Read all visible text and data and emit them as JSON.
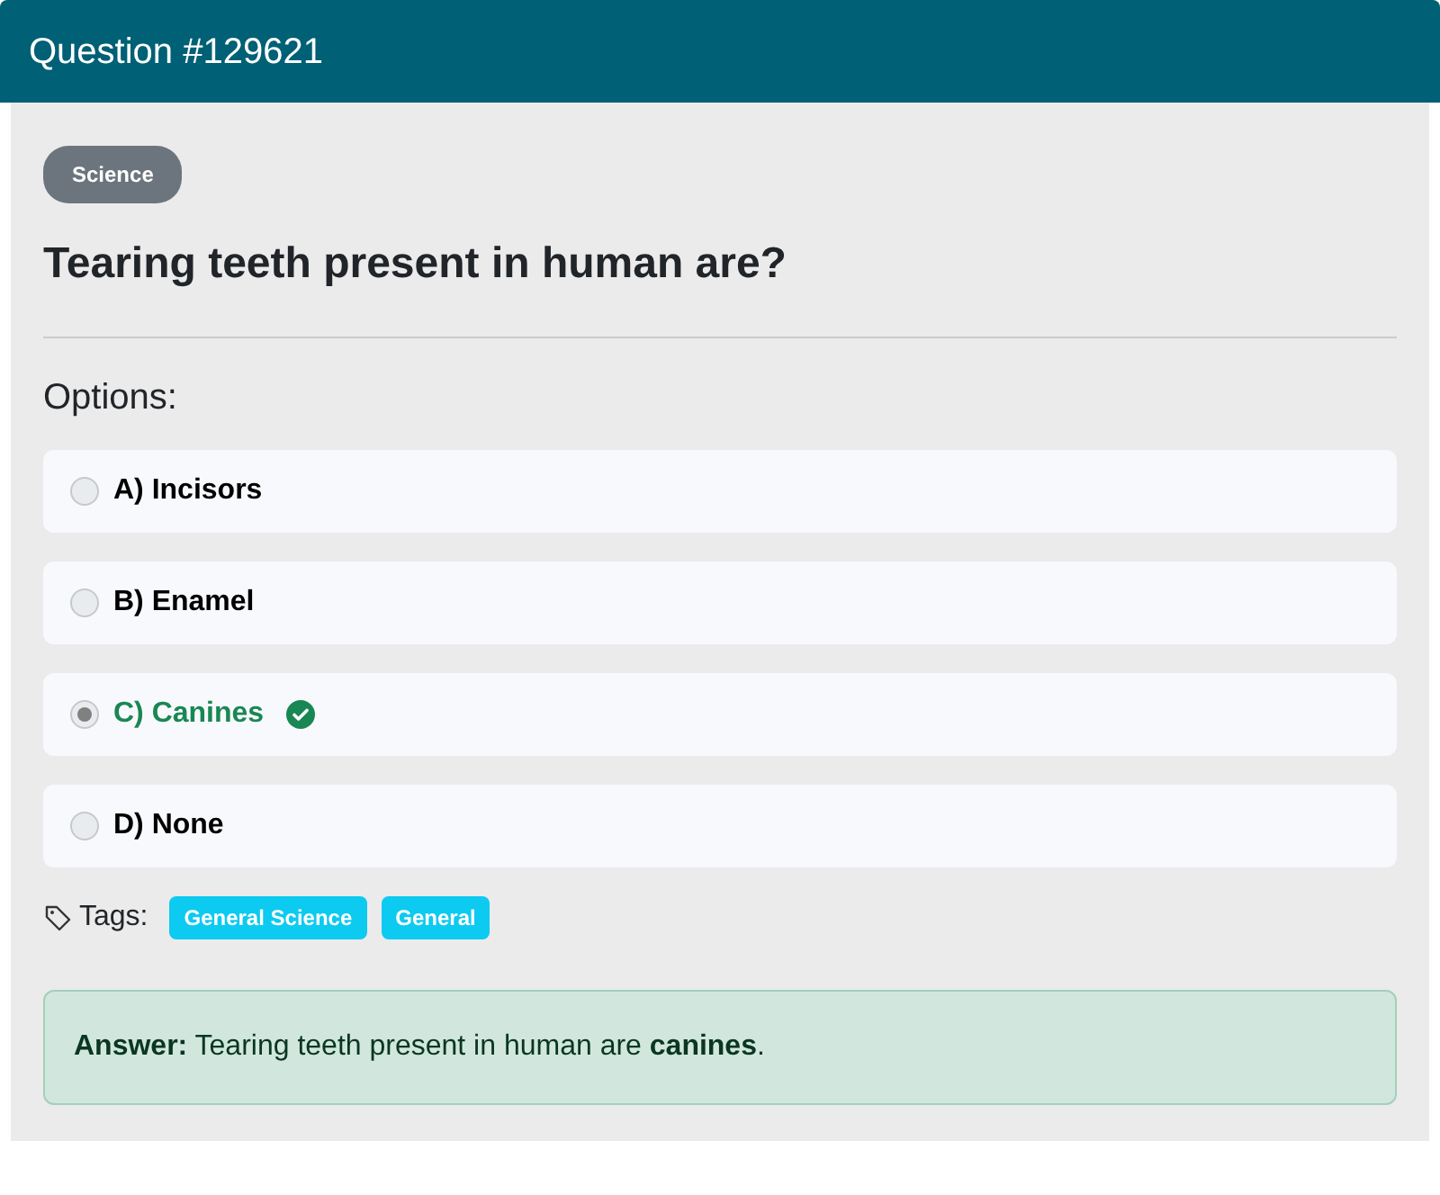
{
  "header": {
    "title": "Question #129621"
  },
  "category": "Science",
  "question": "Tearing teeth present in human are?",
  "options_label": "Options:",
  "options": [
    {
      "label": "A) Incisors",
      "selected": false,
      "correct": false
    },
    {
      "label": "B) Enamel",
      "selected": false,
      "correct": false
    },
    {
      "label": "C) Canines",
      "selected": true,
      "correct": true
    },
    {
      "label": "D) None",
      "selected": false,
      "correct": false
    }
  ],
  "tags_label": "Tags:",
  "tags": [
    "General Science",
    "General"
  ],
  "answer": "**Answer:** Tearing teeth present in human are **canines**."
}
